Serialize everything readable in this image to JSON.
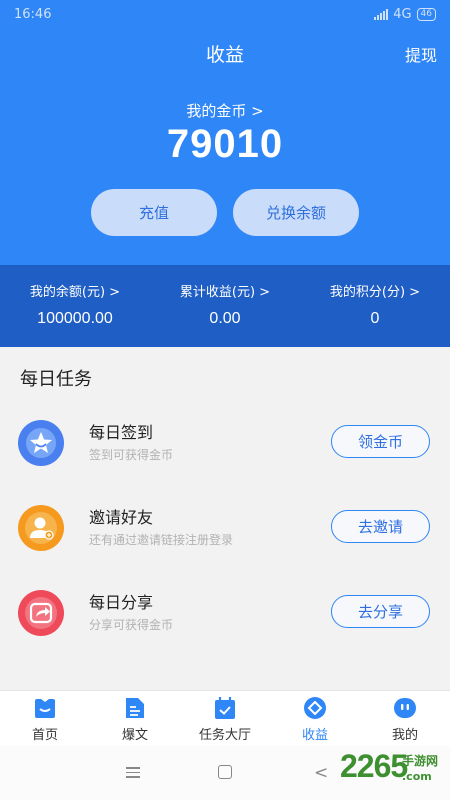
{
  "status_bar": {
    "time": "16:46",
    "network": "4G",
    "battery": "46"
  },
  "header": {
    "title": "收益",
    "withdraw_label": "提现"
  },
  "coins": {
    "label": "我的金币 >",
    "value": "79010"
  },
  "actions": {
    "recharge_label": "充值",
    "exchange_label": "兑换余额"
  },
  "stats": [
    {
      "label": "我的余额(元) >",
      "value": "100000.00"
    },
    {
      "label": "累计收益(元) >",
      "value": "0.00"
    },
    {
      "label": "我的积分(分) >",
      "value": "0"
    }
  ],
  "tasks_section": {
    "title": "每日任务"
  },
  "tasks": [
    {
      "name": "每日签到",
      "desc": "签到可获得金币",
      "button": "领金币",
      "icon": "star-icon",
      "color": "#4a7ff0"
    },
    {
      "name": "邀请好友",
      "desc": "还有通过邀请链接注册登录",
      "button": "去邀请",
      "icon": "user-add-icon",
      "color": "#f59a1e"
    },
    {
      "name": "每日分享",
      "desc": "分享可获得金币",
      "button": "去分享",
      "icon": "share-icon",
      "color": "#ee4a5a"
    }
  ],
  "tabs": [
    {
      "label": "首页",
      "icon": "home-icon"
    },
    {
      "label": "爆文",
      "icon": "article-icon"
    },
    {
      "label": "任务大厅",
      "icon": "calendar-check-icon"
    },
    {
      "label": "收益",
      "icon": "earnings-icon",
      "active": true
    },
    {
      "label": "我的",
      "icon": "profile-icon"
    }
  ],
  "watermark": {
    "brand": "2265",
    "sub1": "手游网",
    "sub2": ".com"
  },
  "colors": {
    "primary": "#2f86f6",
    "stats_bg": "#1f5ec4",
    "pill_bg": "#c9dcf9"
  }
}
